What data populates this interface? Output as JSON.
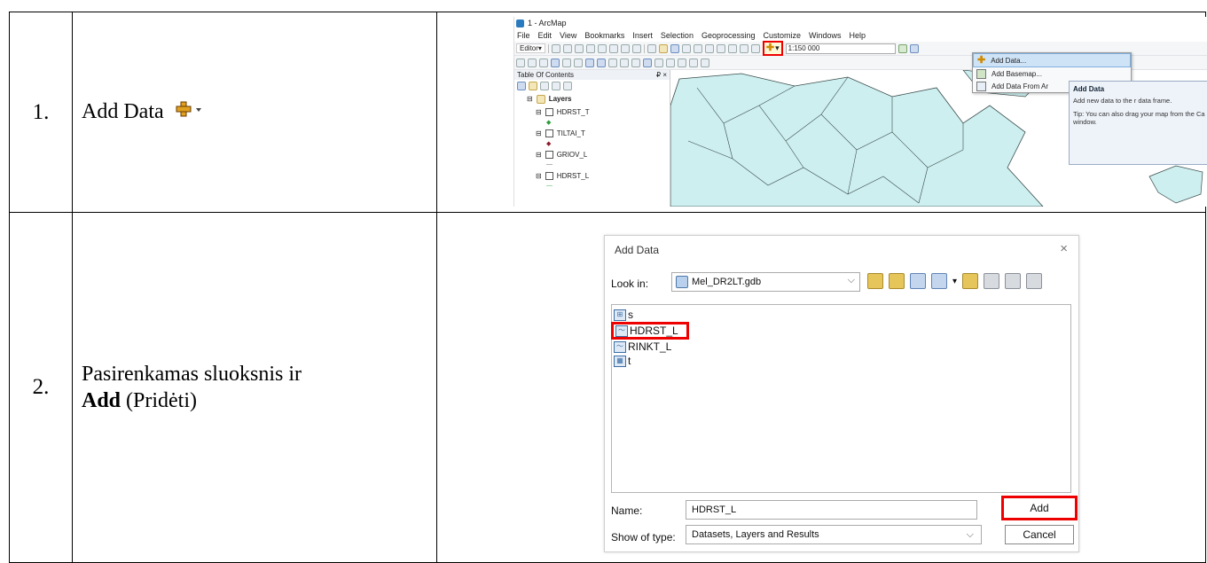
{
  "rows": [
    {
      "number": "1.",
      "text": "Add Data",
      "screenshot": {
        "title": "1 - ArcMap",
        "menu": [
          "File",
          "Edit",
          "View",
          "Bookmarks",
          "Insert",
          "Selection",
          "Geoprocessing",
          "Customize",
          "Windows",
          "Help"
        ],
        "editor_label": "Editor▾",
        "scale": "1:150 000",
        "toc_title": "Table Of Contents",
        "toc_pin": "₽ ×",
        "layers_label": "Layers",
        "toc_layers": [
          "HDRST_T",
          "TILTAI_T",
          "GRIOV_L",
          "HDRST_L"
        ],
        "dropdown": [
          "Add Data...",
          "Add Basemap...",
          "Add Data From Ar"
        ],
        "tooltip_title": "Add Data",
        "tooltip_body": "Add new data to the r data frame.",
        "tooltip_tip": "Tip: You can also drag your map from the Ca window."
      }
    },
    {
      "number": "2.",
      "text_plain": "Pasirenkamas sluoksnis ir",
      "text_bold": "Add",
      "text_suffix": " (Pridėti)",
      "dialog": {
        "title": "Add Data",
        "close": "×",
        "look_in_label": "Look in:",
        "look_in_value": "Mel_DR2LT.gdb",
        "files": [
          "s",
          "HDRST_L",
          "RINKT_L",
          "t"
        ],
        "name_label": "Name:",
        "name_value": "HDRST_L",
        "type_label": "Show of type:",
        "type_value": "Datasets, Layers and Results",
        "add_button": "Add",
        "cancel_button": "Cancel"
      }
    }
  ],
  "colors": {
    "highlight": "#e00000",
    "add_icon": "#d08a00",
    "map_fill": "#cdeff0"
  }
}
